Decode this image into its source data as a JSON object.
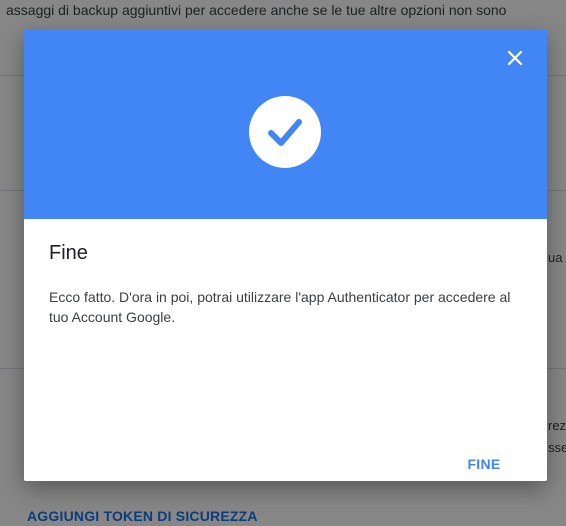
{
  "background": {
    "top_text": "assaggi di backup aggiuntivi per accedere anche se le tue altre opzioni non sono",
    "side_fragments": [
      "ua",
      "rez",
      "sse"
    ],
    "security_key_link": "AGGIUNGI TOKEN DI SICUREZZA"
  },
  "dialog": {
    "header_color": "#4285f4",
    "close_icon": "close-icon",
    "status_icon": "check-circle-icon",
    "title": "Fine",
    "body": "Ecco fatto. D'ora in poi, potrai utilizzare l'app Authenticator per accedere al tuo Account Google.",
    "done_label": "FINE"
  }
}
